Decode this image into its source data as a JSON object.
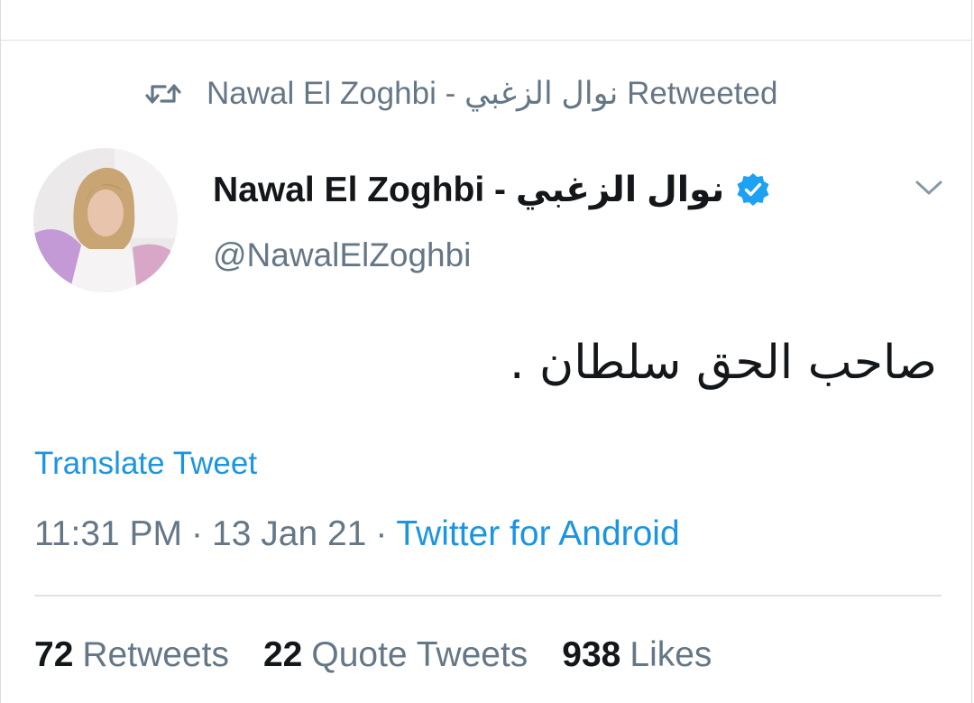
{
  "retweet_banner": {
    "icon": "retweet-icon",
    "text": "Nawal El Zoghbi - نوال الزغبي Retweeted"
  },
  "author": {
    "display_name": "Nawal El Zoghbi - نوال الزغبي",
    "handle": "@NawalElZoghbi",
    "verified_icon": "verified-badge-icon",
    "verified_color": "#1da1f2"
  },
  "tweet": {
    "text": "صاحب الحق سلطان .",
    "translate_label": "Translate Tweet",
    "time": "11:31 PM",
    "separator": "·",
    "date": "13 Jan 21",
    "source": "Twitter for Android"
  },
  "stats": [
    {
      "count": "72",
      "label": "Retweets"
    },
    {
      "count": "22",
      "label": "Quote Tweets"
    },
    {
      "count": "938",
      "label": "Likes"
    }
  ],
  "colors": {
    "link": "#1b95e0",
    "secondary_text": "#657786",
    "primary_text": "#14171a"
  }
}
